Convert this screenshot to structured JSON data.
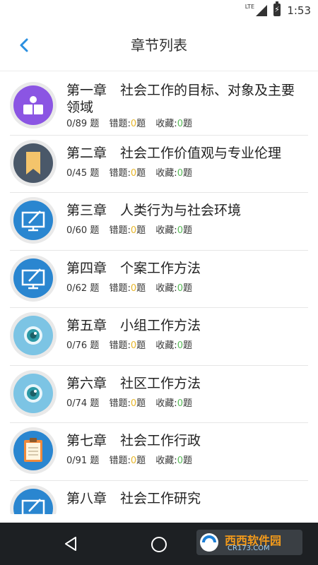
{
  "status_bar": {
    "network": "LTE",
    "time": "1:53"
  },
  "header": {
    "title": "章节列表",
    "back_icon": "chevron-left-icon"
  },
  "labels": {
    "error": "错题:",
    "fav": "收藏:",
    "unit": "题"
  },
  "chapters": [
    {
      "title": "第一章　社会工作的目标、对象及主要领域",
      "progress": "0/89 题",
      "wrong": "0",
      "fav": "0",
      "icon": "reader-icon",
      "color": "#8b55e3"
    },
    {
      "title": "第二章　社会工作价值观与专业伦理",
      "progress": "0/45 题",
      "wrong": "0",
      "fav": "0",
      "icon": "bookmark-icon",
      "color": "#4a5869"
    },
    {
      "title": "第三章　人类行为与社会环境",
      "progress": "0/60 题",
      "wrong": "0",
      "fav": "0",
      "icon": "monitor-pen-icon",
      "color": "#2a86d0"
    },
    {
      "title": "第四章　个案工作方法",
      "progress": "0/62 题",
      "wrong": "0",
      "fav": "0",
      "icon": "monitor-pen-icon",
      "color": "#2a86d0"
    },
    {
      "title": "第五章　小组工作方法",
      "progress": "0/76 题",
      "wrong": "0",
      "fav": "0",
      "icon": "eye-icon",
      "color": "#7cc4e4"
    },
    {
      "title": "第六章　社区工作方法",
      "progress": "0/74 题",
      "wrong": "0",
      "fav": "0",
      "icon": "eye-icon",
      "color": "#7cc4e4"
    },
    {
      "title": "第七章　社会工作行政",
      "progress": "0/91 题",
      "wrong": "0",
      "fav": "0",
      "icon": "clipboard-icon",
      "color": "#2a86d0"
    },
    {
      "title": "第八章　社会工作研究",
      "progress": "",
      "wrong": "",
      "fav": "",
      "icon": "monitor-pen-icon",
      "color": "#2a86d0"
    }
  ],
  "nav": {
    "back": "back-triangle-icon",
    "home": "home-circle-icon"
  },
  "watermark": {
    "brand": "西西软件园",
    "site": "CR173.COM"
  }
}
